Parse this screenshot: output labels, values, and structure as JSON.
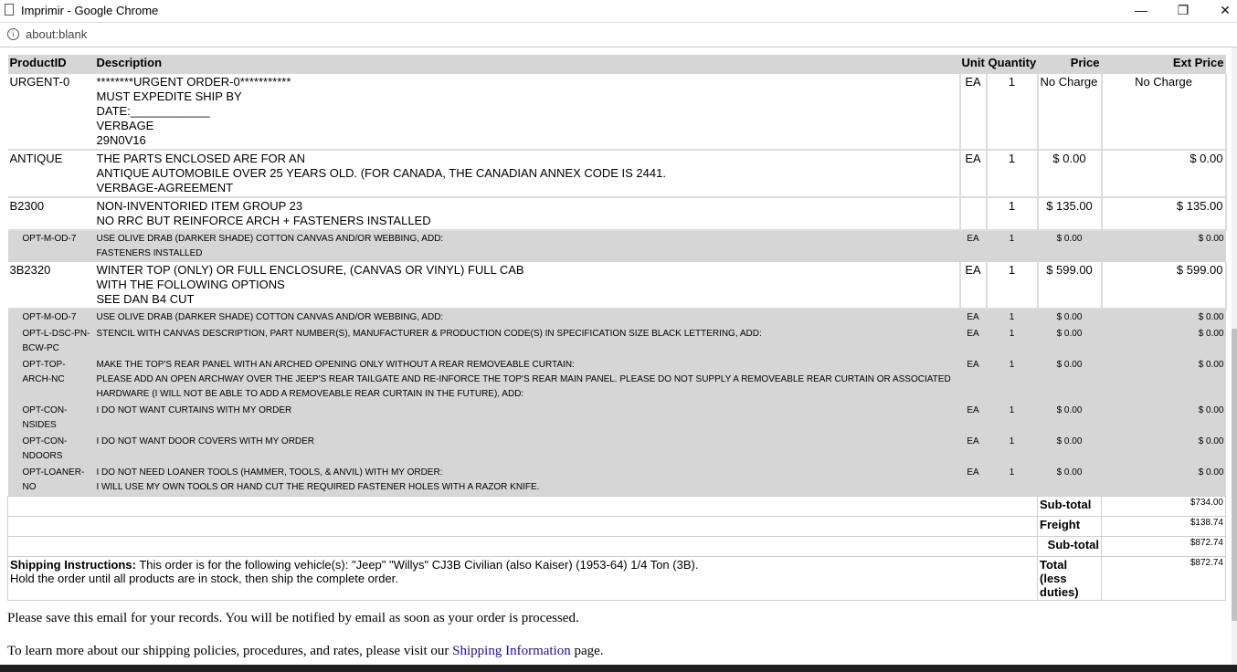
{
  "window": {
    "title": "Imprimir - Google Chrome",
    "minimize": "—",
    "restore": "❐",
    "close": "✕"
  },
  "address": {
    "info": "i",
    "url": "about:blank"
  },
  "table": {
    "headers": {
      "product_id": "ProductID",
      "description": "Description",
      "unit": "Unit",
      "quantity": "Quantity",
      "price": "Price",
      "ext_price": "Ext Price"
    },
    "rows": [
      {
        "pid": "URGENT-0",
        "desc": [
          "********URGENT ORDER-0***********",
          "MUST EXPEDITE SHIP BY",
          "DATE:____________",
          "VERBAGE",
          "29N0V16"
        ],
        "unit": "EA",
        "qty": "1",
        "price": "No Charge",
        "ext": "No Charge"
      },
      {
        "pid": "ANTIQUE",
        "desc": [
          "THE PARTS ENCLOSED ARE FOR AN",
          "ANTIQUE AUTOMOBILE OVER 25 YEARS OLD. (FOR CANADA, THE CANADIAN ANNEX CODE IS 2441.",
          "VERBAGE-AGREEMENT"
        ],
        "unit": "EA",
        "qty": "1",
        "price": "$ 0.00",
        "ext": "$ 0.00"
      },
      {
        "pid": "B2300",
        "desc": [
          "NON-INVENTORIED ITEM GROUP 23",
          "NO RRC BUT REINFORCE ARCH + FASTENERS INSTALLED"
        ],
        "unit": "",
        "qty": "1",
        "price": "$ 135.00",
        "ext": "$ 135.00"
      }
    ],
    "opt1": {
      "pid": "OPT-M-OD-7",
      "desc": [
        "USE OLIVE DRAB (DARKER SHADE) COTTON CANVAS AND/OR WEBBING, ADD:",
        "FASTENERS INSTALLED"
      ],
      "unit": "EA",
      "qty": "1",
      "price": "$ 0.00",
      "ext": "$ 0.00"
    },
    "row4": {
      "pid": "3B2320",
      "desc": [
        "WINTER TOP (ONLY) OR FULL ENCLOSURE, (CANVAS OR VINYL) FULL CAB",
        "WITH THE FOLLOWING OPTIONS",
        "SEE DAN B4 CUT"
      ],
      "unit": "EA",
      "qty": "1",
      "price": "$ 599.00",
      "ext": "$ 599.00"
    },
    "options": [
      {
        "pid": "OPT-M-OD-7",
        "desc": [
          "USE OLIVE DRAB (DARKER SHADE) COTTON CANVAS AND/OR WEBBING, ADD:"
        ],
        "unit": "EA",
        "qty": "1",
        "price": "$ 0.00",
        "ext": "$ 0.00"
      },
      {
        "pid": "OPT-L-DSC-PN-BCW-PC",
        "desc": [
          "STENCIL WITH CANVAS DESCRIPTION, PART NUMBER(S), MANUFACTURER & PRODUCTION CODE(S) IN SPECIFICATION SIZE BLACK LETTERING, ADD:"
        ],
        "unit": "EA",
        "qty": "1",
        "price": "$ 0.00",
        "ext": "$ 0.00"
      },
      {
        "pid": "OPT-TOP-ARCH-NC",
        "desc": [
          "MAKE THE TOP'S REAR PANEL WITH AN ARCHED OPENING ONLY WITHOUT A REAR REMOVEABLE CURTAIN:",
          "PLEASE ADD AN OPEN ARCHWAY OVER THE JEEP'S REAR TAILGATE AND RE-INFORCE THE TOP'S REAR MAIN PANEL. PLEASE DO NOT SUPPLY A REMOVEABLE REAR CURTAIN OR ASSOCIATED HARDWARE (I WILL NOT BE ABLE TO ADD A REMOVEABLE REAR CURTAIN IN THE FUTURE), ADD:"
        ],
        "unit": "EA",
        "qty": "1",
        "price": "$ 0.00",
        "ext": "$ 0.00"
      },
      {
        "pid": "OPT-CON-NSIDES",
        "desc": [
          "I DO NOT WANT CURTAINS WITH MY ORDER"
        ],
        "unit": "EA",
        "qty": "1",
        "price": "$ 0.00",
        "ext": "$ 0.00"
      },
      {
        "pid": "OPT-CON-NDOORS",
        "desc": [
          "I DO NOT WANT DOOR COVERS WITH MY ORDER"
        ],
        "unit": "EA",
        "qty": "1",
        "price": "$ 0.00",
        "ext": "$ 0.00"
      },
      {
        "pid": "OPT-LOANER-NO",
        "desc": [
          "I DO NOT NEED LOANER TOOLS (HAMMER, TOOLS, & ANVIL) WITH MY ORDER:",
          "I WILL USE MY OWN TOOLS OR HAND CUT THE REQUIRED FASTENER HOLES WITH A RAZOR KNIFE."
        ],
        "unit": "EA",
        "qty": "1",
        "price": "$ 0.00",
        "ext": "$ 0.00"
      }
    ],
    "totals": {
      "subtotal1_label": "Sub-total",
      "subtotal1": "$734.00",
      "freight_label": "Freight",
      "freight": "$138.74",
      "subtotal2_label": "Sub-total",
      "subtotal2": "$872.74",
      "total_label": "Total (less duties)",
      "total": "$872.74"
    },
    "shipping": {
      "label": "Shipping Instructions:",
      "line1": "This order is for the following vehicle(s): \"Jeep\" \"Willys\" CJ3B Civilian (also Kaiser) (1953-64) 1/4 Ton (3B).",
      "line2": "Hold the order until all products are in stock, then ship the complete order."
    }
  },
  "footer": {
    "save_note": "Please save this email for your records. You will be notified by email as soon as your order is processed.",
    "learn_prefix": "To learn more about our shipping policies, procedures, and rates, please visit our",
    "learn_link": "Shipping Information",
    "learn_suffix": "page."
  }
}
